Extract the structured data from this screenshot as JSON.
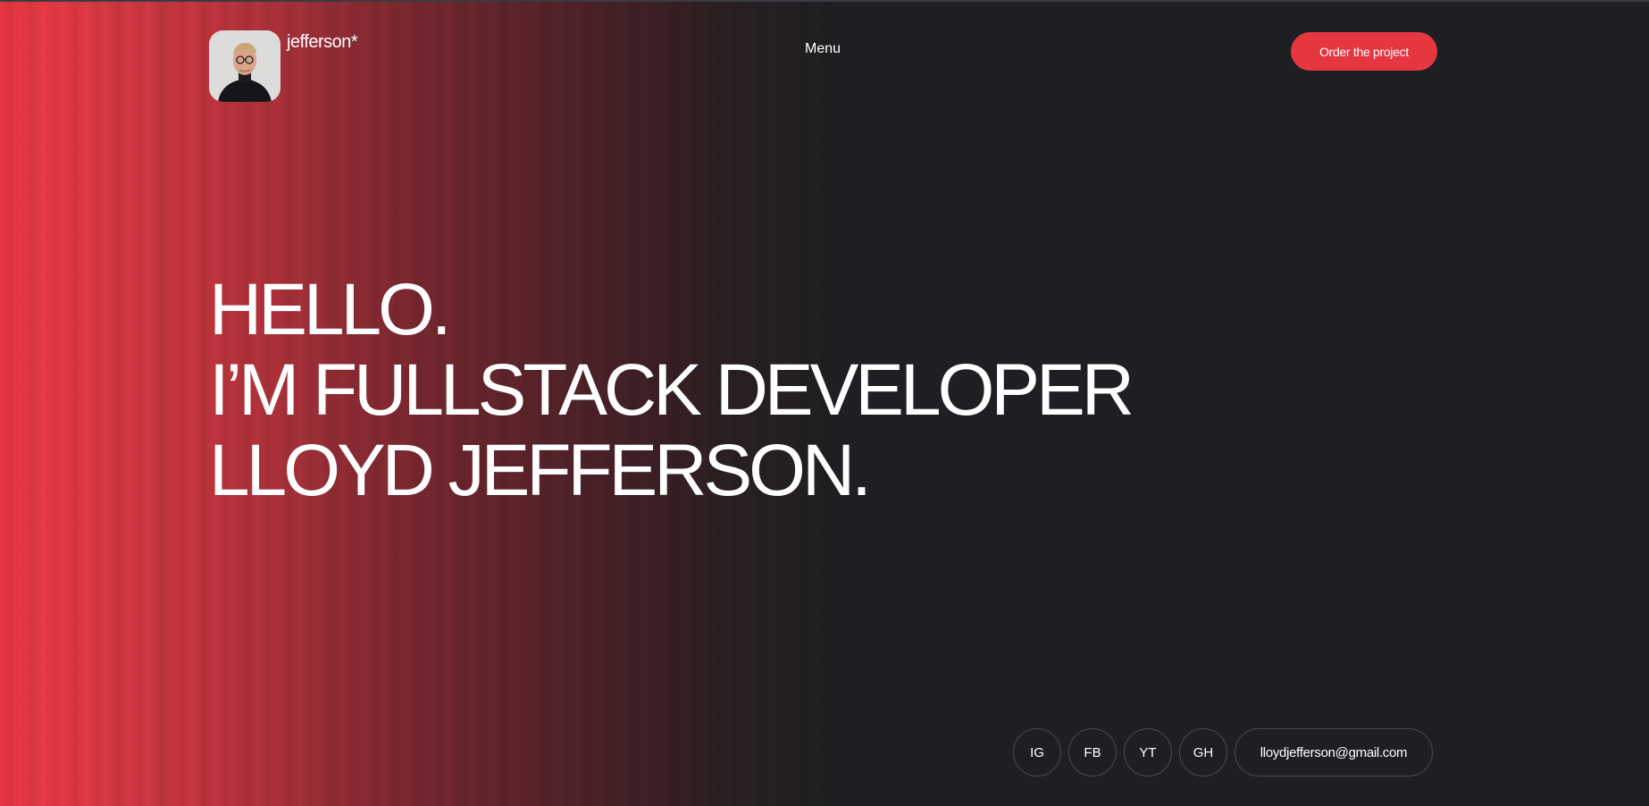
{
  "header": {
    "brand": "jefferson*",
    "menu_label": "Menu",
    "order_button_label": "Order the project"
  },
  "hero": {
    "lines": [
      "HELLO.",
      "I’M FULLSTACK DEVELOPER",
      "LLOYD JEFFERSON."
    ]
  },
  "socials": {
    "items": [
      {
        "label": "IG"
      },
      {
        "label": "FB"
      },
      {
        "label": "YT"
      },
      {
        "label": "GH"
      }
    ],
    "email": "lloydjefferson@gmail.com"
  },
  "colors": {
    "accent": "#e63640",
    "background": "#1e1f22",
    "text": "#ffffff"
  }
}
